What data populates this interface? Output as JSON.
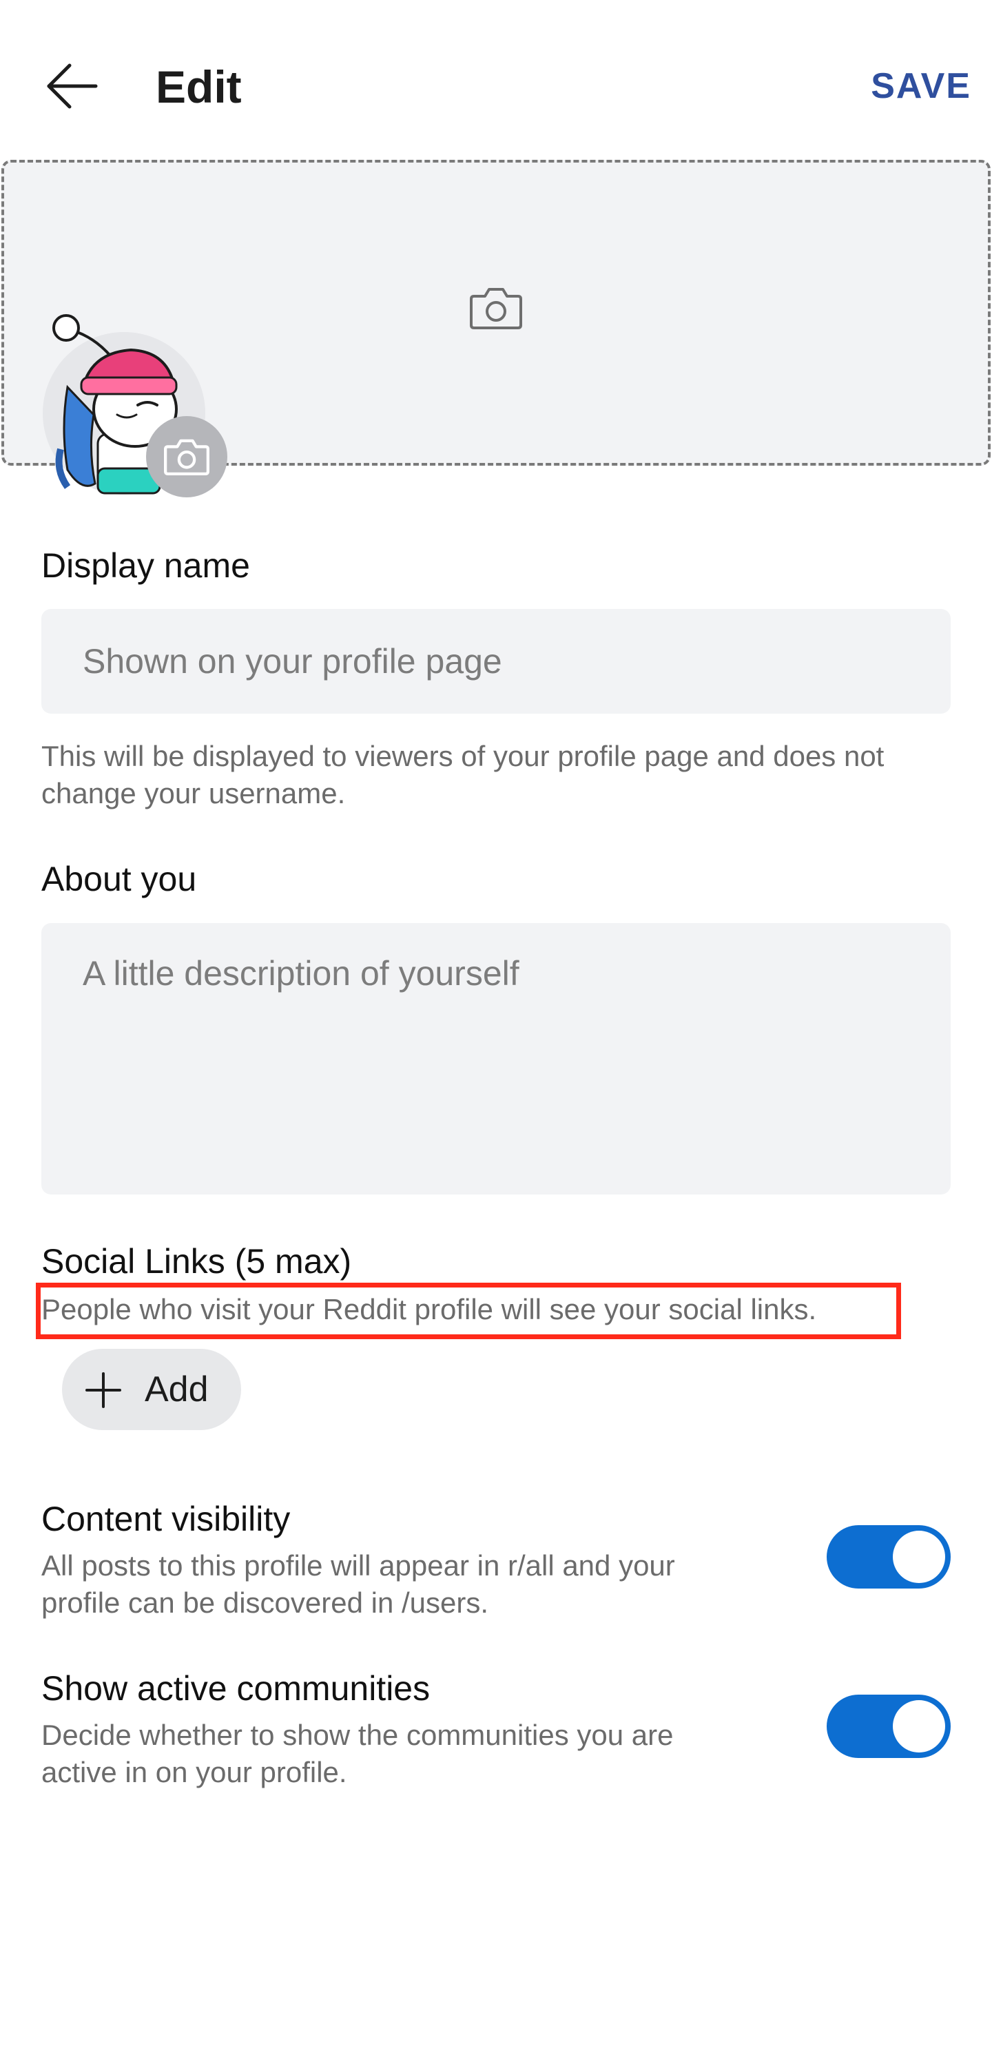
{
  "header": {
    "title": "Edit",
    "save_label": "SAVE",
    "back_icon": "arrow-left-icon"
  },
  "banner": {
    "camera_icon": "camera-icon"
  },
  "avatar": {
    "camera_icon": "camera-icon"
  },
  "display_name": {
    "label": "Display name",
    "placeholder": "Shown on your profile page",
    "value": "",
    "helper": "This will be displayed to viewers of your profile page and does not change your username."
  },
  "about": {
    "label": "About you",
    "placeholder": "A little description of yourself",
    "value": ""
  },
  "social_links": {
    "label": "Social Links (5 max)",
    "helper": "People who visit your Reddit profile will see your social links.",
    "add_label": "Add"
  },
  "settings": [
    {
      "title": "Content visibility",
      "description": "All posts to this profile will appear in r/all and your profile can be discovered in /users.",
      "enabled": true
    },
    {
      "title": "Show active communities",
      "description": "Decide whether to show the communities you are active in on your profile.",
      "enabled": true
    }
  ],
  "colors": {
    "accent_blue": "#2f4f9e",
    "toggle_on": "#0d6ed1",
    "highlight": "#ff2a1a",
    "field_bg": "#f2f3f5"
  }
}
